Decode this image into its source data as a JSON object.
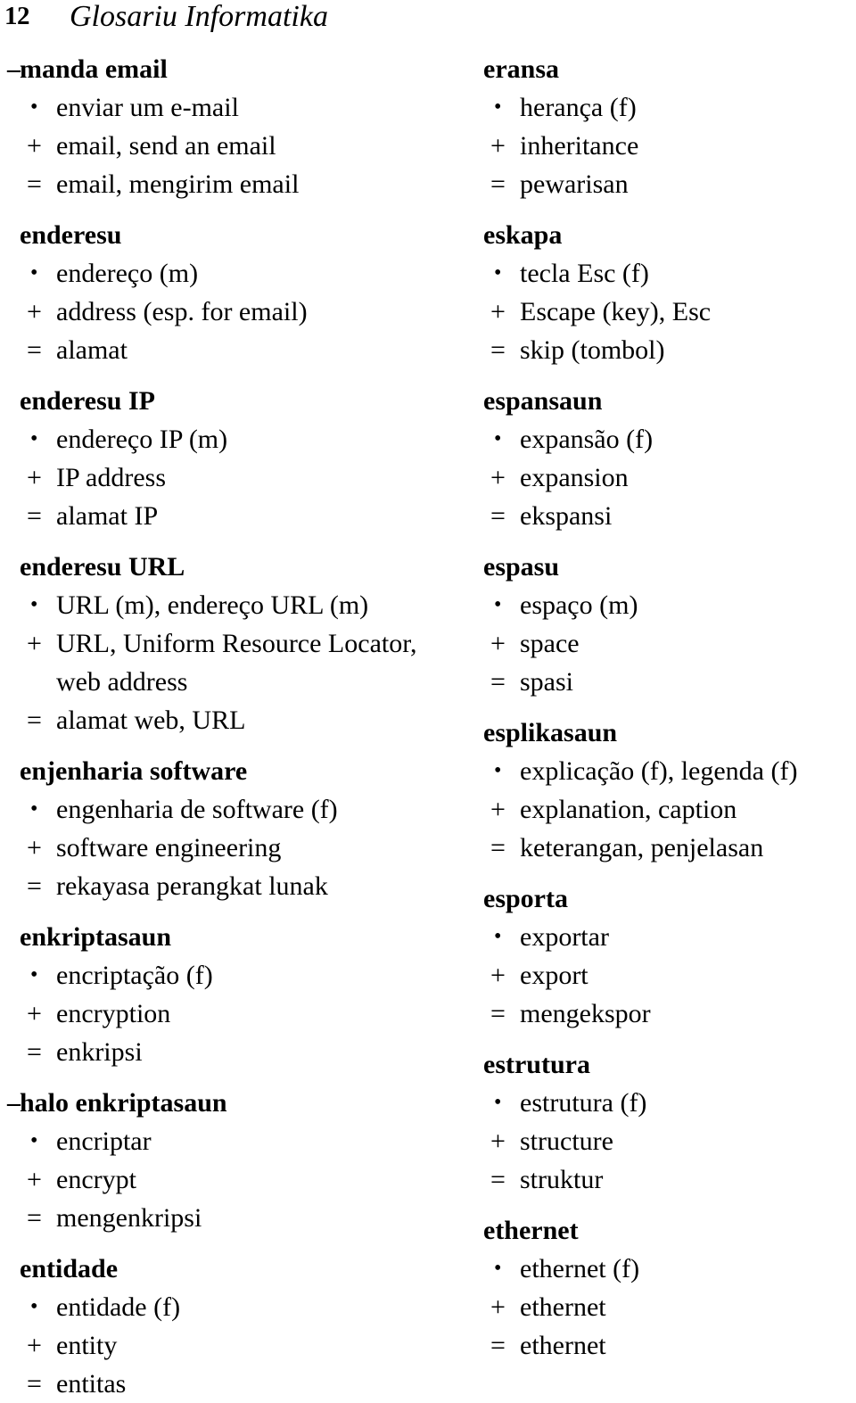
{
  "header": {
    "page_number": "12",
    "title": "Glosariu Informatika"
  },
  "markers": {
    "dash": "–",
    "bullet": "•",
    "plus": "+",
    "equals": "="
  },
  "columns": {
    "left": [
      {
        "dash": "–",
        "headword": "manda email",
        "senses": [
          {
            "marker": "•",
            "text": "enviar um e-mail"
          },
          {
            "marker": "+",
            "text": "email, send an email"
          },
          {
            "marker": "=",
            "text": "email, mengirim email"
          }
        ]
      },
      {
        "dash": "",
        "headword": "enderesu",
        "senses": [
          {
            "marker": "•",
            "text": "endereço (m)"
          },
          {
            "marker": "+",
            "text": "address (esp. for email)"
          },
          {
            "marker": "=",
            "text": "alamat"
          }
        ]
      },
      {
        "dash": "",
        "headword": "enderesu IP",
        "senses": [
          {
            "marker": "•",
            "text": "endereço IP (m)"
          },
          {
            "marker": "+",
            "text": "IP address"
          },
          {
            "marker": "=",
            "text": "alamat IP"
          }
        ]
      },
      {
        "dash": "",
        "headword": "enderesu URL",
        "senses": [
          {
            "marker": "•",
            "text": "URL (m), endereço URL (m)"
          },
          {
            "marker": "+",
            "text": "URL, Uniform Resource Locator, web address"
          },
          {
            "marker": "=",
            "text": "alamat web, URL"
          }
        ]
      },
      {
        "dash": "",
        "headword": "enjenharia software",
        "senses": [
          {
            "marker": "•",
            "text": "engenharia de software (f)"
          },
          {
            "marker": "+",
            "text": "software engineering"
          },
          {
            "marker": "=",
            "text": "rekayasa perangkat lunak"
          }
        ]
      },
      {
        "dash": "",
        "headword": "enkriptasaun",
        "senses": [
          {
            "marker": "•",
            "text": "encriptação (f)"
          },
          {
            "marker": "+",
            "text": "encryption"
          },
          {
            "marker": "=",
            "text": "enkripsi"
          }
        ]
      },
      {
        "dash": "–",
        "headword": "halo enkriptasaun",
        "senses": [
          {
            "marker": "•",
            "text": "encriptar"
          },
          {
            "marker": "+",
            "text": "encrypt"
          },
          {
            "marker": "=",
            "text": "mengenkripsi"
          }
        ]
      },
      {
        "dash": "",
        "headword": "entidade",
        "senses": [
          {
            "marker": "•",
            "text": "entidade (f)"
          },
          {
            "marker": "+",
            "text": "entity"
          },
          {
            "marker": "=",
            "text": "entitas"
          }
        ]
      }
    ],
    "right": [
      {
        "dash": "",
        "headword": "eransa",
        "senses": [
          {
            "marker": "•",
            "text": "herança (f)"
          },
          {
            "marker": "+",
            "text": "inheritance"
          },
          {
            "marker": "=",
            "text": "pewarisan"
          }
        ]
      },
      {
        "dash": "",
        "headword": "eskapa",
        "senses": [
          {
            "marker": "•",
            "text": "tecla Esc (f)"
          },
          {
            "marker": "+",
            "text": "Escape (key), Esc"
          },
          {
            "marker": "=",
            "text": "skip (tombol)"
          }
        ]
      },
      {
        "dash": "",
        "headword": "espansaun",
        "senses": [
          {
            "marker": "•",
            "text": "expansão (f)"
          },
          {
            "marker": "+",
            "text": "expansion"
          },
          {
            "marker": "=",
            "text": "ekspansi"
          }
        ]
      },
      {
        "dash": "",
        "headword": "espasu",
        "senses": [
          {
            "marker": "•",
            "text": "espaço (m)"
          },
          {
            "marker": "+",
            "text": "space"
          },
          {
            "marker": "=",
            "text": "spasi"
          }
        ]
      },
      {
        "dash": "",
        "headword": "esplikasaun",
        "senses": [
          {
            "marker": "•",
            "text": "explicação (f), legenda (f)"
          },
          {
            "marker": "+",
            "text": "explanation, caption"
          },
          {
            "marker": "=",
            "text": "keterangan, penjelasan"
          }
        ]
      },
      {
        "dash": "",
        "headword": "esporta",
        "senses": [
          {
            "marker": "•",
            "text": "exportar"
          },
          {
            "marker": "+",
            "text": "export"
          },
          {
            "marker": "=",
            "text": "mengekspor"
          }
        ]
      },
      {
        "dash": "",
        "headword": "estrutura",
        "senses": [
          {
            "marker": "•",
            "text": "estrutura (f)"
          },
          {
            "marker": "+",
            "text": "structure"
          },
          {
            "marker": "=",
            "text": "struktur"
          }
        ]
      },
      {
        "dash": "",
        "headword": "ethernet",
        "senses": [
          {
            "marker": "•",
            "text": "ethernet (f)"
          },
          {
            "marker": "+",
            "text": "ethernet"
          },
          {
            "marker": "=",
            "text": "ethernet"
          }
        ]
      }
    ]
  }
}
